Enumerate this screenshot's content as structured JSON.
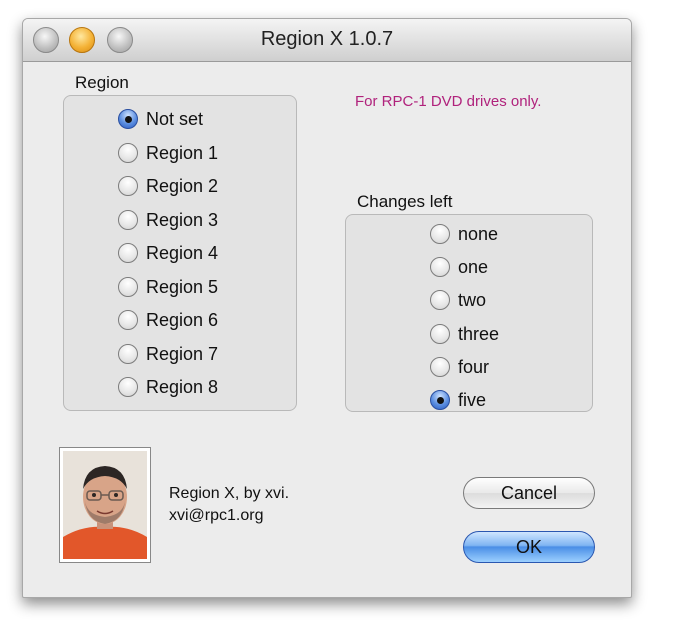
{
  "window": {
    "title": "Region X 1.0.7"
  },
  "region_group": {
    "label": "Region",
    "options": [
      {
        "label": "Not set",
        "selected": true
      },
      {
        "label": "Region 1",
        "selected": false
      },
      {
        "label": "Region 2",
        "selected": false
      },
      {
        "label": "Region 3",
        "selected": false
      },
      {
        "label": "Region 4",
        "selected": false
      },
      {
        "label": "Region 5",
        "selected": false
      },
      {
        "label": "Region 6",
        "selected": false
      },
      {
        "label": "Region 7",
        "selected": false
      },
      {
        "label": "Region 8",
        "selected": false
      }
    ]
  },
  "note": "For RPC-1 DVD drives only.",
  "changes_group": {
    "label": "Changes left",
    "options": [
      {
        "label": "none",
        "selected": false
      },
      {
        "label": "one",
        "selected": false
      },
      {
        "label": "two",
        "selected": false
      },
      {
        "label": "three",
        "selected": false
      },
      {
        "label": "four",
        "selected": false
      },
      {
        "label": "five",
        "selected": true
      }
    ]
  },
  "author": {
    "line1": "Region X, by xvi.",
    "line2": "xvi@rpc1.org"
  },
  "buttons": {
    "cancel_label": "Cancel",
    "ok_label": "OK"
  },
  "colors": {
    "note": "#b0227c",
    "accent": "#4a8ee6"
  }
}
